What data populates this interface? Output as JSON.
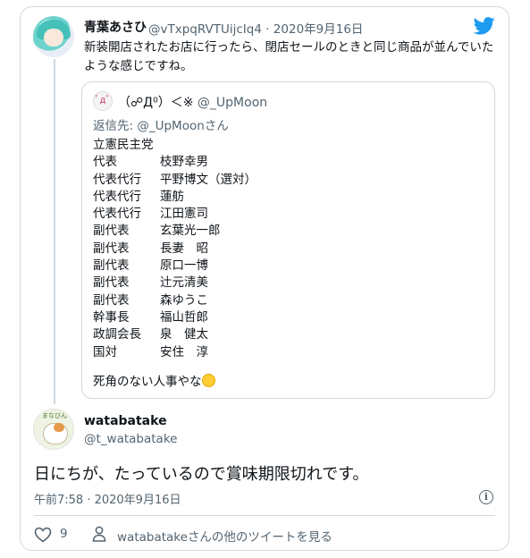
{
  "tweet": {
    "author_name": "青葉あさひ",
    "author_handle": "@vTxpqRVTUijcIq4 · 2020年9月16日",
    "text": "新装開店されたお店に行ったら、閉店セールのときと同じ商品が並んでいたような感じですね。",
    "icons": [
      "avatar",
      "twitter-bird-icon"
    ]
  },
  "quote": {
    "avatar_text": "ﾟдﾟ",
    "author_name": "（☍Д⁰）＜※",
    "author_handle": "@_UpMoon",
    "reply_to": "返信先: @_UpMoonさん",
    "lines": [
      {
        "a": "立憲民主党",
        "b": ""
      },
      {
        "a": "代表",
        "b": "枝野幸男"
      },
      {
        "a": "代表代行",
        "b": "平野博文（選対）"
      },
      {
        "a": "代表代行",
        "b": "蓮舫"
      },
      {
        "a": "代表代行",
        "b": "江田憲司"
      },
      {
        "a": "副代表",
        "b": "玄葉光一郎"
      },
      {
        "a": "副代表",
        "b": "長妻　昭"
      },
      {
        "a": "副代表",
        "b": "原口一博"
      },
      {
        "a": "副代表",
        "b": "辻元清美"
      },
      {
        "a": "副代表",
        "b": "森ゆうこ"
      },
      {
        "a": "幹事長",
        "b": "福山哲郎"
      },
      {
        "a": "政調会長",
        "b": "泉　健太"
      },
      {
        "a": "国対",
        "b": "安住　淳"
      }
    ],
    "footer": "死角のない人事やな",
    "footer_emoji": "rolling-on-floor-laughing"
  },
  "reply": {
    "author_name": "watabatake",
    "author_handle": "@t_watabatake",
    "avatar_text": "まなびん",
    "text": "日にちが、たっているので賞味期限切れです。",
    "timestamp": "午前7:58 · 2020年9月16日",
    "info_glyph": "i"
  },
  "actions": {
    "likes": "9",
    "more_tweets": "watabatakeさんの他のツイートを見る"
  },
  "colors": {
    "twitter_blue": "#1d9bf0",
    "muted": "#536471",
    "border": "#cfd9de"
  }
}
